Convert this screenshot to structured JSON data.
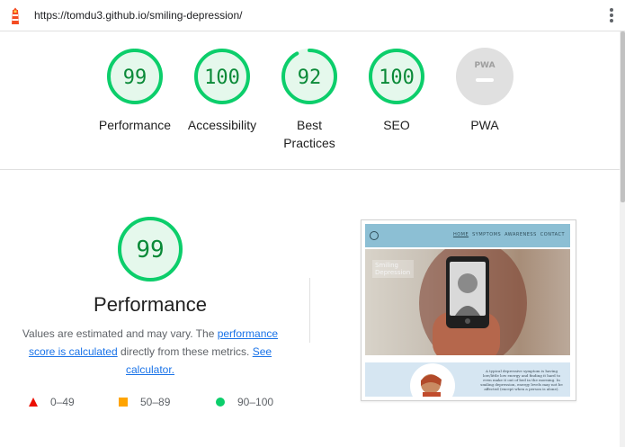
{
  "browser": {
    "url": "https://tomdu3.github.io/smiling-depression/",
    "logo_icon": "lighthouse-icon",
    "menu_icon": "kebab-menu-icon"
  },
  "gauges": [
    {
      "score": "99",
      "label": "Performance",
      "value": 99
    },
    {
      "score": "100",
      "label": "Accessibility",
      "value": 100
    },
    {
      "score": "92",
      "label": "Best Practices",
      "value": 92
    },
    {
      "score": "100",
      "label": "SEO",
      "value": 100
    },
    {
      "label": "PWA",
      "badge": "PWA"
    }
  ],
  "performance": {
    "score": "99",
    "value": 99,
    "title": "Performance",
    "desc_prefix": "Values are estimated and may vary. The ",
    "desc_link1": "performance score is calculated",
    "desc_middle": " directly from these metrics. ",
    "desc_link2": "See calculator."
  },
  "legend": [
    {
      "range": "0–49",
      "color": "#eb0f00",
      "shape": "triangle"
    },
    {
      "range": "50–89",
      "color": "#ffa400",
      "shape": "square"
    },
    {
      "range": "90–100",
      "color": "#0cce6b",
      "shape": "circle"
    }
  ],
  "thumbnail": {
    "nav_links": [
      "HOME",
      "SYMPTOMS",
      "AWARENESS",
      "CONTACT"
    ],
    "hero_title": "Smiling Depression",
    "body_text": "A typical depressive symptom is having low/little low energy and finding it hard to even make it out of bed in the morning. In smiling depression, energy levels may not be affected (except when a person is alone)."
  },
  "colors": {
    "pass_green": "#0cce6b",
    "pass_text": "#0a8a38",
    "pass_fill": "#e5f8ec",
    "link": "#1a73e8",
    "pwa_gray": "#e0e0e0"
  }
}
